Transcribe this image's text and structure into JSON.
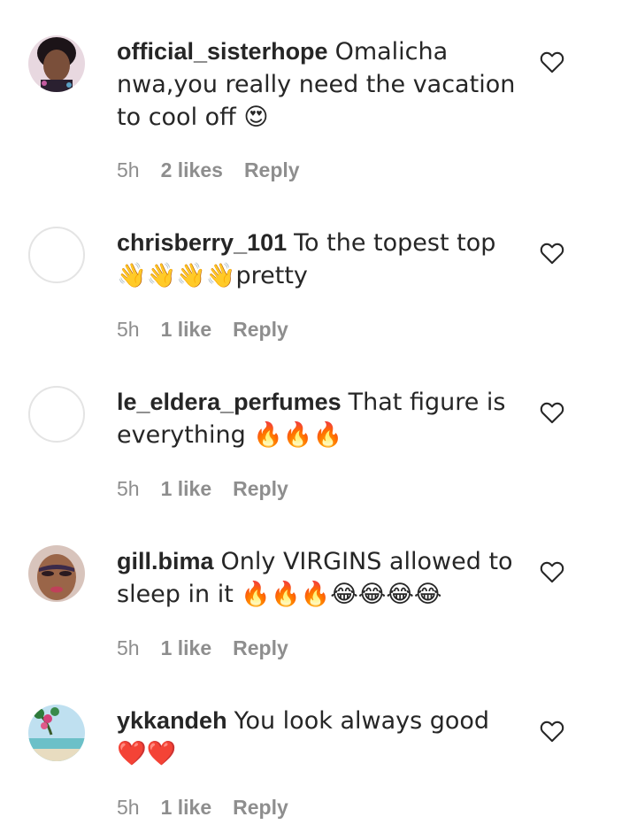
{
  "comments": [
    {
      "username": "official_sisterhope",
      "text": "Omalicha nwa,you really need the vacation to cool off 😍",
      "time": "5h",
      "likes": "2 likes",
      "reply": "Reply",
      "avatar": "photo"
    },
    {
      "username": "chrisberry_101",
      "text": "To the topest top👋👋👋👋pretty",
      "time": "5h",
      "likes": "1 like",
      "reply": "Reply",
      "avatar": "empty"
    },
    {
      "username": "le_eldera_perfumes",
      "text": "That figure is everything 🔥🔥🔥",
      "time": "5h",
      "likes": "1 like",
      "reply": "Reply",
      "avatar": "empty"
    },
    {
      "username": "gill.bima",
      "text": "Only VIRGINS allowed to sleep in it 🔥🔥🔥😂😂😂😂",
      "time": "5h",
      "likes": "1 like",
      "reply": "Reply",
      "avatar": "photo"
    },
    {
      "username": "ykkandeh",
      "text": "You look always good ❤️❤️",
      "time": "5h",
      "likes": "1 like",
      "reply": "Reply",
      "avatar": "photo"
    }
  ],
  "icons": {
    "like": "heart-outline-icon"
  },
  "colors": {
    "text": "#262626",
    "meta": "#8e8e8e",
    "avatar_border": "#e4e4e4"
  }
}
